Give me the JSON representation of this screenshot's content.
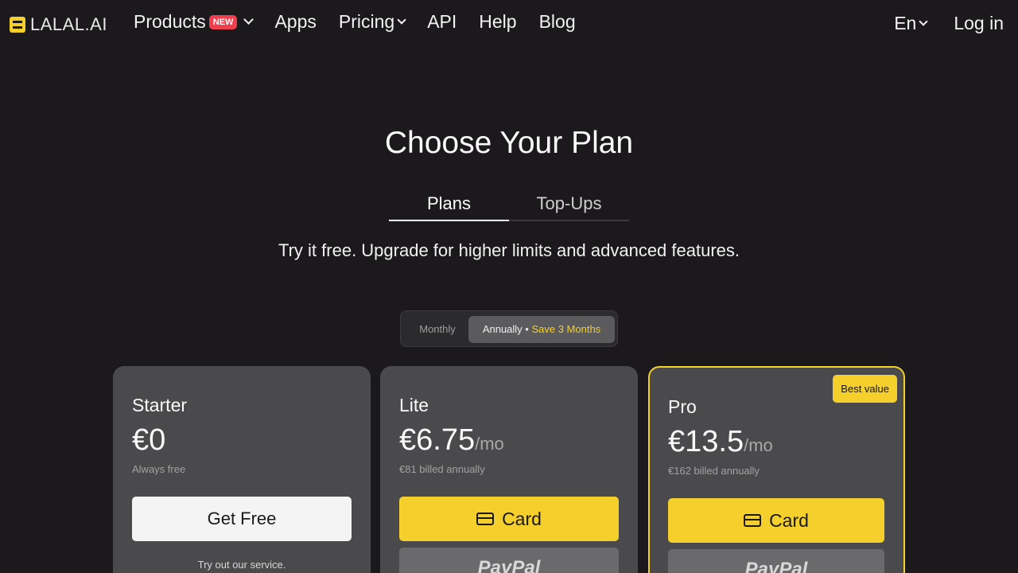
{
  "header": {
    "logo_text": "LALAL.AI",
    "nav": {
      "products": "Products",
      "products_badge": "NEW",
      "apps": "Apps",
      "pricing": "Pricing",
      "api": "API",
      "help": "Help",
      "blog": "Blog"
    },
    "language": "En",
    "login": "Log in"
  },
  "hero": {
    "title": "Choose Your Plan",
    "tabs": [
      {
        "label": "Plans",
        "active": true
      },
      {
        "label": "Top-Ups",
        "active": false
      }
    ],
    "subtitle": "Try it free. Upgrade for higher limits and advanced features."
  },
  "billing_toggle": {
    "monthly": "Monthly",
    "annually": "Annually •",
    "save": "Save 3 Months",
    "selected": "annually"
  },
  "plans": {
    "starter": {
      "name": "Starter",
      "price": "€0",
      "note": "Always free",
      "button": "Get Free",
      "tagline": "Try out our service."
    },
    "lite": {
      "name": "Lite",
      "price": "€6.75",
      "per": "/mo",
      "note": "€81 billed annually",
      "card_button": "Card",
      "paypal_button": "PayPal"
    },
    "pro": {
      "name": "Pro",
      "price": "€13.5",
      "per": "/mo",
      "note": "€162 billed annually",
      "badge": "Best value",
      "card_button": "Card",
      "paypal_button": "PayPal"
    }
  },
  "colors": {
    "background": "#1b191b",
    "accent": "#f5cf2b",
    "card": "#4a494b",
    "new_badge": "#ef3e4d"
  }
}
